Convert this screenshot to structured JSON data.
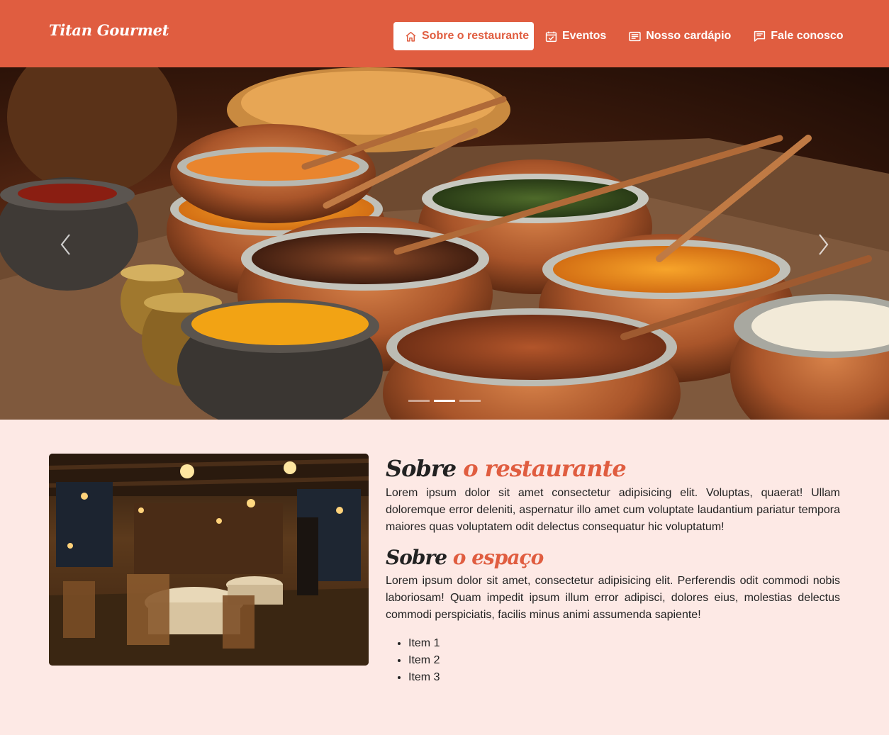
{
  "header": {
    "logo": "Titan Gourmet",
    "nav": [
      {
        "label": "Sobre o restaurante",
        "icon": "home-icon",
        "active": true
      },
      {
        "label": "Eventos",
        "icon": "calendar-check-icon",
        "active": false
      },
      {
        "label": "Nosso cardápio",
        "icon": "menu-list-icon",
        "active": false
      },
      {
        "label": "Fale conosco",
        "icon": "chat-icon",
        "active": false
      }
    ]
  },
  "carousel": {
    "prev_icon": "chevron-left-icon",
    "next_icon": "chevron-right-icon",
    "slide_count": 3,
    "active_slide": 2
  },
  "about": {
    "title_plain": "Sobre",
    "title_accent": "o restaurante",
    "text": "Lorem ipsum dolor sit amet consectetur adipisicing elit. Voluptas, quaerat! Ullam doloremque error deleniti, aspernatur illo amet cum voluptate laudantium pariatur tempora maiores quas voluptatem odit delectus consequatur hic voluptatum!"
  },
  "space": {
    "title_plain": "Sobre",
    "title_accent": "o espaço",
    "text": "Lorem ipsum dolor sit amet, consectetur adipisicing elit. Perferendis odit commodi nobis laboriosam! Quam impedit ipsum illum error adipisci, dolores eius, molestias delectus commodi perspiciatis, facilis minus animi assumenda sapiente!",
    "items": [
      "Item 1",
      "Item 2",
      "Item 3"
    ]
  },
  "colors": {
    "brand": "#e05d40",
    "background": "#fde9e5"
  }
}
